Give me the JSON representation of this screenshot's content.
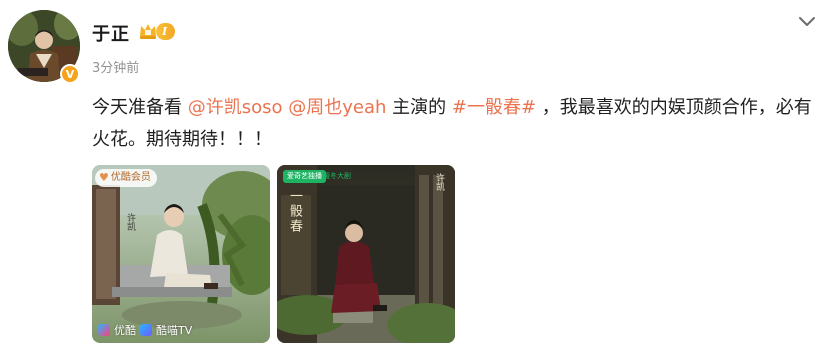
{
  "post": {
    "author": {
      "name": "于正",
      "level_badge": "I",
      "verified_mark": "V"
    },
    "timestamp": "3分钟前",
    "text_segments": [
      {
        "type": "text",
        "value": "今天准备看 "
      },
      {
        "type": "mention",
        "value": "@许凯soso"
      },
      {
        "type": "text",
        "value": " "
      },
      {
        "type": "mention",
        "value": "@周也yeah"
      },
      {
        "type": "text",
        "value": " 主演的 "
      },
      {
        "type": "topic",
        "value": "#一骰春#"
      },
      {
        "type": "text",
        "value": " ，我最喜欢的内娱顶颜合作，必有火花。期待期待！！！"
      }
    ],
    "images": [
      {
        "vip_tag": "优酷会员",
        "watermark": [
          "优酷",
          "酷喵TV"
        ],
        "poster_name": "许凯"
      },
      {
        "platform_tag": "爱奇艺独播",
        "platform_tag_2": "暖冬大剧",
        "poster_title": "一骰春",
        "poster_name": "许凯"
      }
    ]
  },
  "icons": {
    "crown": "crown-icon",
    "menu": "chevron-down-icon"
  },
  "colors": {
    "link": "#eb7350",
    "timestamp": "#939393",
    "badge": "#f4a623"
  }
}
